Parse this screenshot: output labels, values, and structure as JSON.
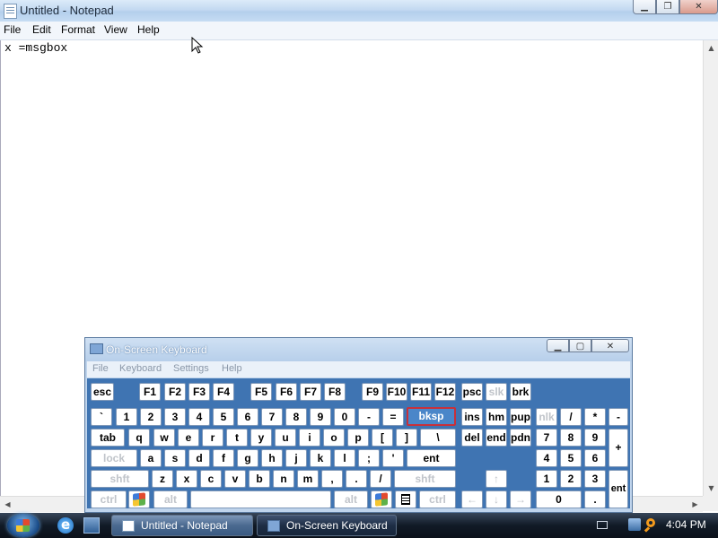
{
  "notepad": {
    "title": "Untitled - Notepad",
    "menu": [
      "File",
      "Edit",
      "Format",
      "View",
      "Help"
    ],
    "content": "x =msgbox"
  },
  "osk": {
    "title": "On-Screen Keyboard",
    "menu": [
      "File",
      "Keyboard",
      "Settings",
      "Help"
    ],
    "keys": {
      "row0": [
        "esc",
        "F1",
        "F2",
        "F3",
        "F4",
        "F5",
        "F6",
        "F7",
        "F8",
        "F9",
        "F10",
        "F11",
        "F12",
        "psc",
        "slk",
        "brk"
      ],
      "row1": [
        "`",
        "1",
        "2",
        "3",
        "4",
        "5",
        "6",
        "7",
        "8",
        "9",
        "0",
        "-",
        "=",
        "bksp",
        "ins",
        "hm",
        "pup",
        "nlk",
        "/",
        "*",
        "-"
      ],
      "row2": [
        "tab",
        "q",
        "w",
        "e",
        "r",
        "t",
        "y",
        "u",
        "i",
        "o",
        "p",
        "[",
        "]",
        "\\",
        "del",
        "end",
        "pdn",
        "7",
        "8",
        "9",
        "+"
      ],
      "row3": [
        "lock",
        "a",
        "s",
        "d",
        "f",
        "g",
        "h",
        "j",
        "k",
        "l",
        ";",
        "'",
        "ent",
        "4",
        "5",
        "6"
      ],
      "row4": [
        "shft",
        "z",
        "x",
        "c",
        "v",
        "b",
        "n",
        "m",
        ",",
        ".",
        "/",
        "shft",
        "↑",
        "1",
        "2",
        "3"
      ],
      "row5": [
        "ctrl",
        "alt",
        "",
        "alt",
        "ctrl",
        "←",
        "↓",
        "→",
        "0",
        ".",
        "ent"
      ]
    },
    "pressed_key": "bksp"
  },
  "taskbar": {
    "items": [
      "Untitled - Notepad",
      "On-Screen Keyboard"
    ],
    "clock": "4:04 PM"
  },
  "icons": {
    "start": "windows-logo",
    "quicklaunch": [
      "internet-explorer-icon",
      "switch-windows-icon"
    ],
    "tray": [
      "keyboard-icon",
      "network-icon",
      "search-icon"
    ]
  }
}
